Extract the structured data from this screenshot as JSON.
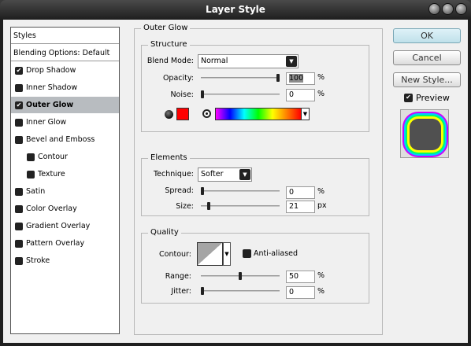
{
  "window": {
    "title": "Layer Style"
  },
  "styles_list": {
    "header": "Styles",
    "blending": "Blending Options: Default",
    "items": [
      {
        "label": "Drop Shadow",
        "checked": true,
        "selected": false,
        "indent": false
      },
      {
        "label": "Inner Shadow",
        "checked": false,
        "selected": false,
        "indent": false
      },
      {
        "label": "Outer Glow",
        "checked": true,
        "selected": true,
        "indent": false
      },
      {
        "label": "Inner Glow",
        "checked": false,
        "selected": false,
        "indent": false
      },
      {
        "label": "Bevel and Emboss",
        "checked": false,
        "selected": false,
        "indent": false
      },
      {
        "label": "Contour",
        "checked": false,
        "selected": false,
        "indent": true
      },
      {
        "label": "Texture",
        "checked": false,
        "selected": false,
        "indent": true
      },
      {
        "label": "Satin",
        "checked": false,
        "selected": false,
        "indent": false
      },
      {
        "label": "Color Overlay",
        "checked": false,
        "selected": false,
        "indent": false
      },
      {
        "label": "Gradient Overlay",
        "checked": false,
        "selected": false,
        "indent": false
      },
      {
        "label": "Pattern Overlay",
        "checked": false,
        "selected": false,
        "indent": false
      },
      {
        "label": "Stroke",
        "checked": false,
        "selected": false,
        "indent": false
      }
    ]
  },
  "panel": {
    "title": "Outer Glow",
    "structure": {
      "title": "Structure",
      "blend_mode_label": "Blend Mode:",
      "blend_mode": "Normal",
      "opacity_label": "Opacity:",
      "opacity": "100",
      "noise_label": "Noise:",
      "noise": "0",
      "percent": "%",
      "color": "#ff0000",
      "opacity_pct": 100,
      "noise_pct": 0
    },
    "elements": {
      "title": "Elements",
      "technique_label": "Technique:",
      "technique": "Softer",
      "spread_label": "Spread:",
      "spread": "0",
      "size_label": "Size:",
      "size": "21",
      "percent": "%",
      "px": "px",
      "spread_pct": 0,
      "size_pct": 8
    },
    "quality": {
      "title": "Quality",
      "contour_label": "Contour:",
      "anti_aliased_label": "Anti-aliased",
      "anti_aliased": false,
      "range_label": "Range:",
      "range": "50",
      "jitter_label": "Jitter:",
      "jitter": "0",
      "percent": "%",
      "range_pct": 50,
      "jitter_pct": 0
    }
  },
  "buttons": {
    "ok": "OK",
    "cancel": "Cancel",
    "new_style": "New Style..."
  },
  "preview": {
    "label": "Preview",
    "checked": true
  }
}
